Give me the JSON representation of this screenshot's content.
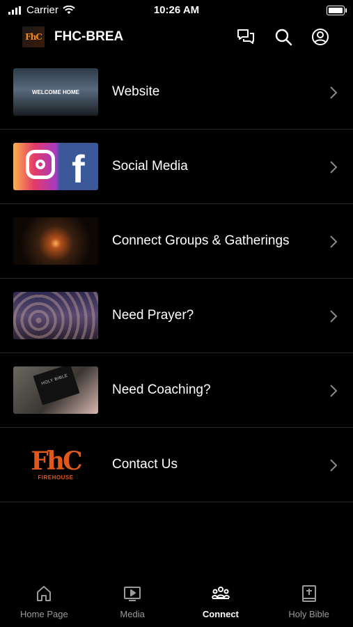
{
  "status_bar": {
    "carrier": "Carrier",
    "time": "10:26 AM"
  },
  "header": {
    "logo_text": "FhC",
    "title": "FHC-BREA",
    "icons": [
      "chat-icon",
      "search-icon",
      "profile-icon"
    ]
  },
  "menu": [
    {
      "label": "Website",
      "thumb_text": "WELCOME HOME"
    },
    {
      "label": "Social Media"
    },
    {
      "label": "Connect Groups & Gatherings"
    },
    {
      "label": "Need Prayer?"
    },
    {
      "label": "Need Coaching?",
      "thumb_text": "HOLY BIBLE"
    },
    {
      "label": "Contact Us",
      "thumb_text": "FhC",
      "thumb_sub": "FIREHOUSE"
    }
  ],
  "tabs": [
    {
      "label": "Home Page",
      "icon": "home-icon"
    },
    {
      "label": "Media",
      "icon": "tv-play-icon"
    },
    {
      "label": "Connect",
      "icon": "people-icon",
      "active": true
    },
    {
      "label": "Holy Bible",
      "icon": "bible-icon"
    }
  ],
  "colors": {
    "background": "#000000",
    "text": "#ffffff",
    "inactive_tab": "#9a9a9a",
    "divider": "#2a2a2a",
    "brand_orange": "#e0581a"
  }
}
